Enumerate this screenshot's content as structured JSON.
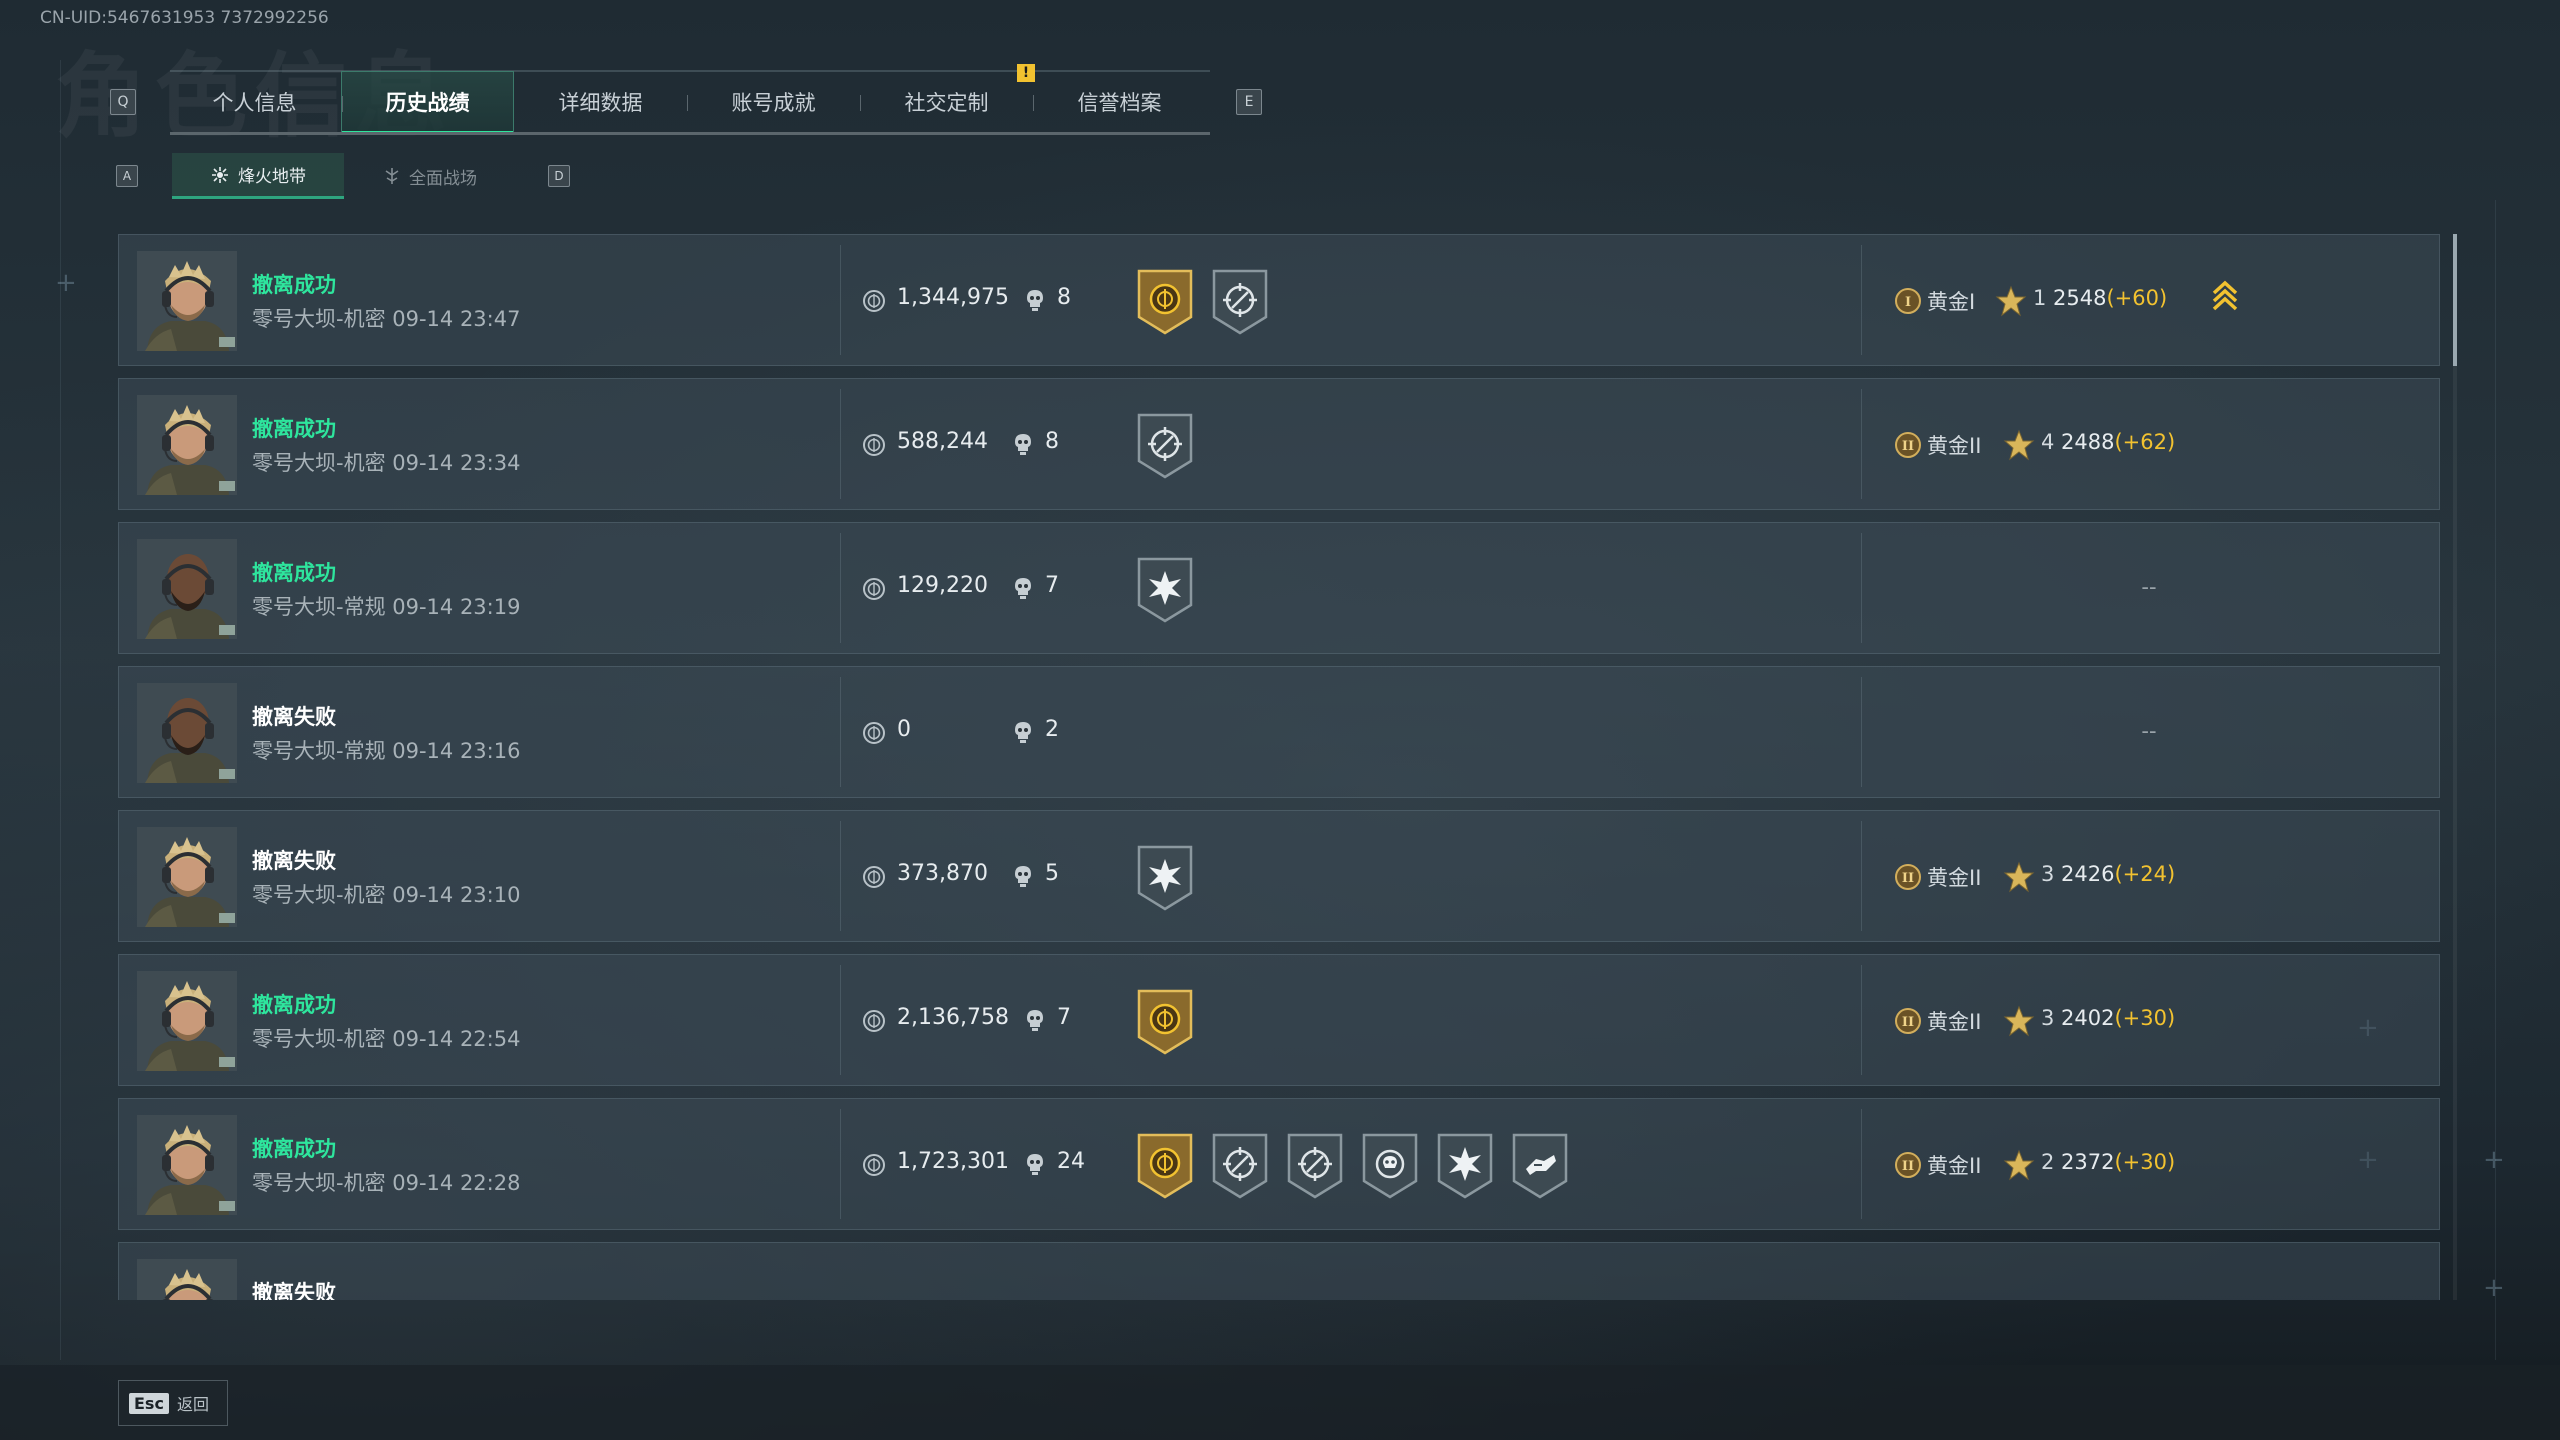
{
  "header": {
    "uid": "CN-UID:5467631953 7372992256",
    "bg_title": "角色信息"
  },
  "tabs": {
    "left_key": "Q",
    "right_key": "E",
    "items": [
      {
        "label": "个人信息"
      },
      {
        "label": "历史战绩",
        "active": true
      },
      {
        "label": "详细数据"
      },
      {
        "label": "账号成就"
      },
      {
        "label": "社交定制",
        "notify": "!"
      },
      {
        "label": "信誉档案"
      }
    ],
    "notify_mark": "!"
  },
  "subtabs": {
    "left_key": "A",
    "right_key": "D",
    "items": [
      {
        "label": "烽火地带",
        "active": true
      },
      {
        "label": "全面战场"
      }
    ]
  },
  "matches": [
    {
      "status": "撤离成功",
      "result": "success",
      "detail": "零号大坝-机密 09-14 23:47",
      "assets": "1,344,975",
      "kills": "8",
      "avatar": "blond",
      "badges": [
        "gold-coin",
        "crosshair"
      ],
      "rank": "黄金I",
      "rank_numeral": "I",
      "stars": "1",
      "score": "2548",
      "delta": "(+60)",
      "promo": true
    },
    {
      "status": "撤离成功",
      "result": "success",
      "detail": "零号大坝-机密 09-14 23:34",
      "assets": "588,244",
      "kills": "8",
      "avatar": "blond",
      "badges": [
        "crosshair"
      ],
      "rank": "黄金II",
      "rank_numeral": "II",
      "stars": "4",
      "score": "2488",
      "delta": "(+62)",
      "promo": false
    },
    {
      "status": "撤离成功",
      "result": "success",
      "detail": "零号大坝-常规 09-14 23:19",
      "assets": "129,220",
      "kills": "7",
      "avatar": "bald",
      "badges": [
        "burst"
      ],
      "rank": "",
      "empty": "--"
    },
    {
      "status": "撤离失败",
      "result": "fail",
      "detail": "零号大坝-常规 09-14 23:16",
      "assets": "0",
      "kills": "2",
      "avatar": "bald",
      "badges": [],
      "rank": "",
      "empty": "--"
    },
    {
      "status": "撤离失败",
      "result": "fail",
      "detail": "零号大坝-机密 09-14 23:10",
      "assets": "373,870",
      "kills": "5",
      "avatar": "blond",
      "badges": [
        "burst"
      ],
      "rank": "黄金II",
      "rank_numeral": "II",
      "stars": "3",
      "score": "2426",
      "delta": "(+24)",
      "promo": false
    },
    {
      "status": "撤离成功",
      "result": "success",
      "detail": "零号大坝-机密 09-14 22:54",
      "assets": "2,136,758",
      "kills": "7",
      "avatar": "blond",
      "badges": [
        "gold-coin"
      ],
      "rank": "黄金II",
      "rank_numeral": "II",
      "stars": "3",
      "score": "2402",
      "delta": "(+30)",
      "promo": false
    },
    {
      "status": "撤离成功",
      "result": "success",
      "detail": "零号大坝-机密 09-14 22:28",
      "assets": "1,723,301",
      "kills": "24",
      "avatar": "blond",
      "badges": [
        "gold-coin",
        "crosshair",
        "crosshair",
        "skull-wings",
        "burst",
        "hands"
      ],
      "rank": "黄金II",
      "rank_numeral": "II",
      "stars": "2",
      "score": "2372",
      "delta": "(+30)",
      "promo": false
    },
    {
      "status": "撤离失败",
      "result": "fail",
      "detail": "",
      "assets": "",
      "kills": "",
      "avatar": "blond",
      "badges": [],
      "rank": "",
      "partial": true,
      "promo": true
    }
  ],
  "footer": {
    "esc_key": "Esc",
    "esc_label": "返回"
  },
  "colors": {
    "success": "#2ee59d",
    "gold": "#f2c230",
    "accent": "#2ee59d"
  }
}
